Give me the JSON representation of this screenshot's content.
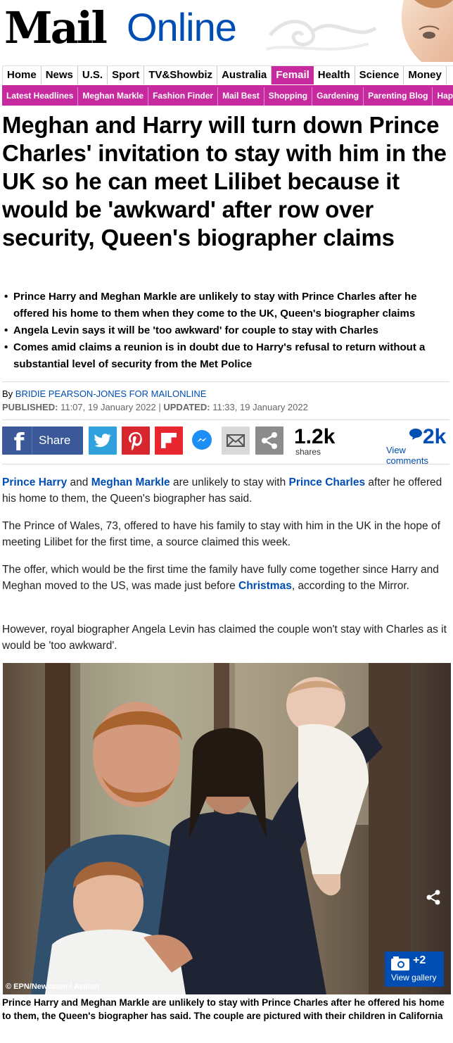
{
  "masthead": {
    "logo_mail": "Mail",
    "logo_online": "Online"
  },
  "nav_primary": [
    {
      "label": "Home"
    },
    {
      "label": "News"
    },
    {
      "label": "U.S."
    },
    {
      "label": "Sport"
    },
    {
      "label": "TV&Showbiz"
    },
    {
      "label": "Australia"
    },
    {
      "label": "Femail",
      "active": true
    },
    {
      "label": "Health"
    },
    {
      "label": "Science"
    },
    {
      "label": "Money"
    }
  ],
  "nav_secondary": [
    {
      "label": "Latest Headlines"
    },
    {
      "label": "Meghan Markle"
    },
    {
      "label": "Fashion Finder"
    },
    {
      "label": "Mail Best"
    },
    {
      "label": "Shopping"
    },
    {
      "label": "Gardening"
    },
    {
      "label": "Parenting Blog"
    },
    {
      "label": "Hap"
    }
  ],
  "article": {
    "headline": "Meghan and Harry will turn down Prince Charles' invitation to stay with him in the UK so he can meet Lilibet because it would be 'awkward' after row over security, Queen's biographer claims",
    "bullets": [
      "Prince Harry and Meghan Markle are unlikely to stay with Prince Charles after he offered his home to them when they come to the UK, Queen's biographer claims",
      "Angela Levin says it will be 'too awkward' for couple to stay with Charles",
      "Comes amid claims a reunion is in doubt due to Harry's refusal to return without a substantial level of security from the Met Police"
    ],
    "byline_prefix": "By",
    "author": "BRIDIE PEARSON-JONES FOR MAILONLINE",
    "published_label": "PUBLISHED:",
    "published": "11:07, 19 January 2022",
    "separator": "|",
    "updated_label": "UPDATED:",
    "updated": "11:33, 19 January 2022",
    "p1": {
      "link1": "Prince Harry",
      "t1": " and ",
      "link2": "Meghan Markle",
      "t2": " are unlikely to stay with ",
      "link3": "Prince Charles",
      "t3": " after he offered his home to them, the Queen's biographer has said."
    },
    "p2": "The Prince of Wales, 73, offered to have his family to stay with him in the UK in the hope of meeting Lilibet for the first time, a source claimed this week.",
    "p3": {
      "t1": "The offer, which would be the first time the family have fully come together since Harry and Meghan moved to the US, was made just before ",
      "link1": "Christmas",
      "t2": ", according to the Mirror."
    },
    "p4": "However, royal biographer Angela Levin has claimed the couple won't stay with Charles as it would be 'too awkward'.",
    "photo_credit": "© EPN/Newscom / Avalon",
    "gallery_count": "+2",
    "gallery_label": "View gallery",
    "caption": "Prince Harry and Meghan Markle are unlikely to stay with Prince Charles after he offered his home to them, the Queen's biographer has said. The couple are pictured with their children in California"
  },
  "share": {
    "facebook_label": "Share",
    "count": "1.2k",
    "count_label": "shares",
    "comments_count": "2k",
    "comments_label": "View comments"
  },
  "colors": {
    "femail_accent": "#c72a9e",
    "link_blue": "#004db3",
    "facebook": "#3b5998",
    "twitter": "#2fa2dd",
    "pinterest": "#d8262f"
  },
  "icons": [
    "facebook-icon",
    "twitter-icon",
    "pinterest-icon",
    "flipboard-icon",
    "messenger-icon",
    "email-icon",
    "share-icon",
    "comment-bubble-icon",
    "camera-icon"
  ]
}
